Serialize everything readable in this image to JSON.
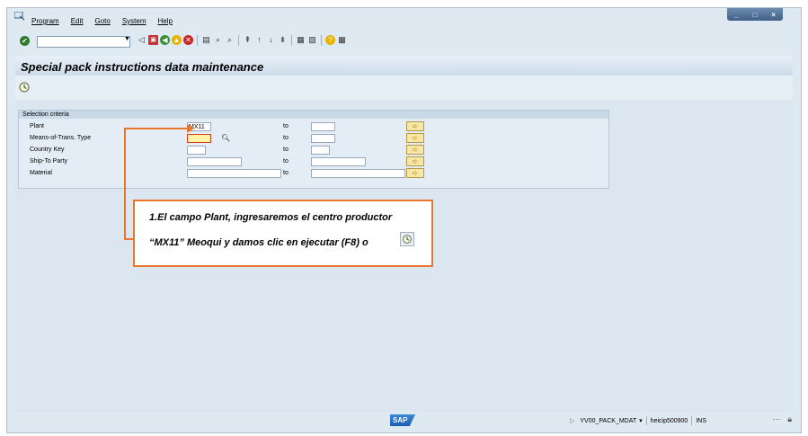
{
  "menu": {
    "items": [
      "Program",
      "Edit",
      "Goto",
      "System",
      "Help"
    ]
  },
  "window_controls": [
    "_",
    "□",
    "×"
  ],
  "toolbar": {
    "command_field_value": "",
    "icons": [
      "enter-icon",
      "back-icon",
      "save-icon",
      "back-green-icon",
      "exit-yellow-icon",
      "cancel-red-icon",
      "print-icon",
      "find-icon",
      "find-next-icon",
      "first-page-icon",
      "previous-page-icon",
      "next-page-icon",
      "last-page-icon",
      "new-session-icon",
      "shortcut-icon",
      "help-icon",
      "customize-layout-icon"
    ]
  },
  "screen": {
    "title": "Special pack instructions data maintenance"
  },
  "selection": {
    "group_title": "Selection criteria",
    "to_label": "to",
    "rows": [
      {
        "label": "Plant",
        "from": "MX11",
        "to": ""
      },
      {
        "label": "Means-of-Trans. Type",
        "from": "",
        "to": ""
      },
      {
        "label": "Country Key",
        "from": "",
        "to": ""
      },
      {
        "label": "Ship-To Party",
        "from": "",
        "to": ""
      },
      {
        "label": "Material",
        "from": "",
        "to": ""
      }
    ]
  },
  "callout": {
    "line1": "1.El campo Plant, ingresaremos el centro productor",
    "line2": "“MX11” Meoqui y damos clic en ejecutar (F8) o"
  },
  "status": {
    "logo": "SAP",
    "transaction": "YV00_PACK_MDAT",
    "server": "heicip500900",
    "mode": "INS"
  },
  "colors": {
    "accent": "#e8762c",
    "background": "#dfe9f2",
    "required_field": "#fff4a8"
  }
}
